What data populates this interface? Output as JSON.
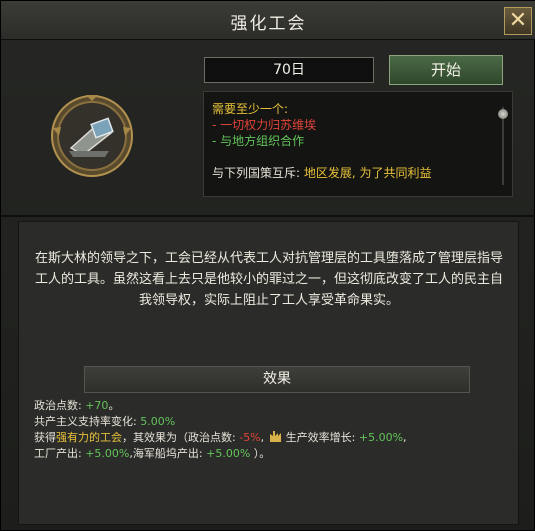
{
  "title": "强化工会",
  "close_icon": "close-icon",
  "duration": "70日",
  "start_label": "开始",
  "requirements": {
    "header": "需要至少一个:",
    "items": [
      "- 一切权力归苏维埃",
      "- 与地方组织合作"
    ],
    "exclusive_label": "与下列国策互斥:",
    "exclusive_items": [
      "地区发展",
      "为了共同利益"
    ]
  },
  "description": "在斯大林的领导之下，工会已经从代表工人对抗管理层的工具堕落成了管理层指导工人的工具。虽然这看上去只是他较小的罪过之一，但这彻底改变了工人的民主自我领导权，实际上阻止了工人享受革命果实。",
  "effects": {
    "header": "效果",
    "pp_label": "政治点数:",
    "pp_value": "+70",
    "support_label": "共产主义支持率变化:",
    "support_value": "5.00%",
    "gain_prefix": "获得",
    "idea_name": "强有力的工会",
    "gain_mid": "，其效果为（政治点数:",
    "pp_pct": "-5%",
    "prod_label": "生产效率增长:",
    "prod_value": "+5.00%",
    "factory_label": "工厂产出:",
    "factory_value": "+5.00%",
    "dockyard_label": "海军船坞产出:",
    "dockyard_value": "+5.00%",
    "close_paren": "）。"
  },
  "colors": {
    "requirement_header": "#e8c23a",
    "requirement_item": "#e0443a",
    "requirement_met": "#63c35a",
    "positive": "#63c35a",
    "negative": "#e0443a"
  }
}
